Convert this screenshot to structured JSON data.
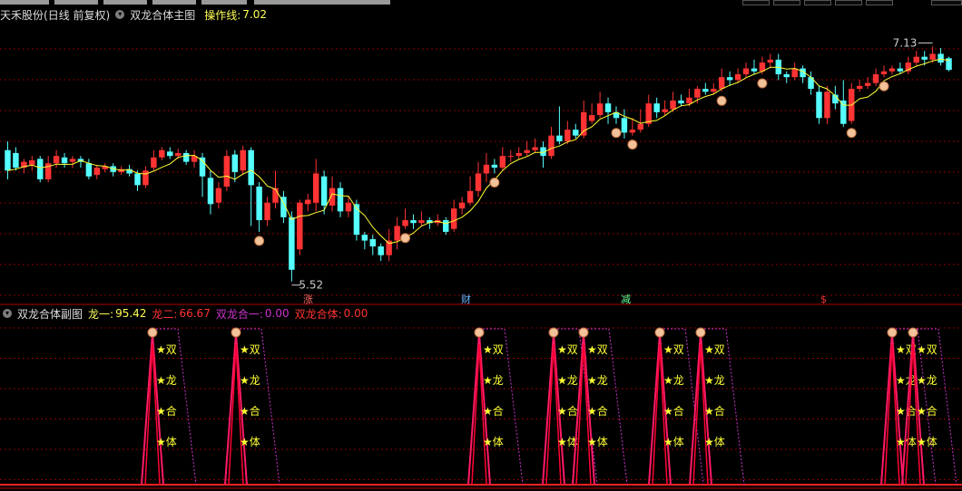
{
  "main_panel": {
    "stock_name": "天禾股份",
    "period": "(日线 前复权)",
    "indicator_name": "双龙合体主图",
    "op_label": "操作线:",
    "op_value": "7.02",
    "high_label": "7.13",
    "low_label": "5.52",
    "markers": [
      "涨",
      "财",
      "减",
      "$"
    ],
    "marker_colors": [
      "#ff6666",
      "#66b3ff",
      "#66ff99",
      "#ff3333"
    ]
  },
  "sub_panel": {
    "indicator_name": "双龙合体副图",
    "fields": [
      {
        "label": "龙一:",
        "value": "95.42",
        "color": "#ffff55"
      },
      {
        "label": "龙二:",
        "value": "66.67",
        "color": "#ff3333"
      },
      {
        "label": "双龙合一:",
        "value": "0.00",
        "color": "#cc33cc"
      },
      {
        "label": "双龙合体:",
        "value": "0.00",
        "color": "#ff3333"
      }
    ],
    "star_labels": [
      "★双",
      "★龙",
      "★合",
      "★体"
    ]
  },
  "colors": {
    "up": "#ff3333",
    "down": "#55ffff",
    "ma": "#ffff33",
    "grid": "#8a0000",
    "pink": "#cc33cc"
  },
  "chart_data": {
    "type": "candlestick",
    "title": "双龙合体主图",
    "ylabel": "",
    "ylim": [
      5.4,
      7.3
    ],
    "candles": [
      [
        6.42,
        6.28,
        6.48,
        6.22
      ],
      [
        6.4,
        6.3,
        6.44,
        6.28
      ],
      [
        6.3,
        6.34,
        6.36,
        6.26
      ],
      [
        6.32,
        6.35,
        6.38,
        6.28
      ],
      [
        6.36,
        6.22,
        6.38,
        6.2
      ],
      [
        6.22,
        6.33,
        6.38,
        6.2
      ],
      [
        6.33,
        6.38,
        6.42,
        6.3
      ],
      [
        6.37,
        6.33,
        6.4,
        6.3
      ],
      [
        6.34,
        6.36,
        6.38,
        6.3
      ],
      [
        6.36,
        6.34,
        6.38,
        6.3
      ],
      [
        6.33,
        6.24,
        6.36,
        6.22
      ],
      [
        6.25,
        6.3,
        6.32,
        6.22
      ],
      [
        6.29,
        6.31,
        6.33,
        6.27
      ],
      [
        6.31,
        6.27,
        6.33,
        6.24
      ],
      [
        6.27,
        6.29,
        6.31,
        6.25
      ],
      [
        6.29,
        6.26,
        6.32,
        6.24
      ],
      [
        6.26,
        6.18,
        6.28,
        6.14
      ],
      [
        6.18,
        6.28,
        6.31,
        6.16
      ],
      [
        6.3,
        6.37,
        6.42,
        6.28
      ],
      [
        6.37,
        6.42,
        6.44,
        6.35
      ],
      [
        6.41,
        6.38,
        6.44,
        6.36
      ],
      [
        6.38,
        6.4,
        6.43,
        6.36
      ],
      [
        6.4,
        6.34,
        6.42,
        6.32
      ],
      [
        6.34,
        6.38,
        6.42,
        6.3
      ],
      [
        6.37,
        6.24,
        6.4,
        6.1
      ],
      [
        6.23,
        6.05,
        6.28,
        5.98
      ],
      [
        6.06,
        6.16,
        6.2,
        6.02
      ],
      [
        6.17,
        6.38,
        6.42,
        6.14
      ],
      [
        6.39,
        6.27,
        6.42,
        6.2
      ],
      [
        6.28,
        6.42,
        6.45,
        6.25
      ],
      [
        6.42,
        6.18,
        6.44,
        5.9
      ],
      [
        6.17,
        5.94,
        6.2,
        5.86
      ],
      [
        5.94,
        6.06,
        6.1,
        5.9
      ],
      [
        6.06,
        6.16,
        6.28,
        6.02
      ],
      [
        6.1,
        5.96,
        6.14,
        5.92
      ],
      [
        5.96,
        5.6,
        6.0,
        5.52
      ],
      [
        5.74,
        6.06,
        6.08,
        5.7
      ],
      [
        6.05,
        6.08,
        6.12,
        6.0
      ],
      [
        6.06,
        6.26,
        6.36,
        6.0
      ],
      [
        6.24,
        6.04,
        6.28,
        5.98
      ],
      [
        6.04,
        6.16,
        6.24,
        6.0
      ],
      [
        6.16,
        6.0,
        6.2,
        5.96
      ],
      [
        6.0,
        6.06,
        6.1,
        5.96
      ],
      [
        6.05,
        5.84,
        6.08,
        5.8
      ],
      [
        5.84,
        5.8,
        5.86,
        5.74
      ],
      [
        5.81,
        5.76,
        5.84,
        5.7
      ],
      [
        5.76,
        5.7,
        5.78,
        5.66
      ],
      [
        5.7,
        5.8,
        5.88,
        5.66
      ],
      [
        5.8,
        5.9,
        5.96,
        5.74
      ],
      [
        5.9,
        5.94,
        6.02,
        5.88
      ],
      [
        5.94,
        5.92,
        5.98,
        5.88
      ],
      [
        5.92,
        5.94,
        6.0,
        5.9
      ],
      [
        5.94,
        5.92,
        5.96,
        5.88
      ],
      [
        5.92,
        5.94,
        5.98,
        5.9
      ],
      [
        5.94,
        5.86,
        5.96,
        5.84
      ],
      [
        5.88,
        6.02,
        6.08,
        5.86
      ],
      [
        6.02,
        6.06,
        6.1,
        5.98
      ],
      [
        6.06,
        6.14,
        6.24,
        6.04
      ],
      [
        6.14,
        6.26,
        6.34,
        6.1
      ],
      [
        6.26,
        6.32,
        6.4,
        6.2
      ],
      [
        6.32,
        6.3,
        6.36,
        6.26
      ],
      [
        6.3,
        6.38,
        6.44,
        6.28
      ],
      [
        6.38,
        6.38,
        6.42,
        6.34
      ],
      [
        6.38,
        6.4,
        6.44,
        6.36
      ],
      [
        6.4,
        6.42,
        6.48,
        6.38
      ],
      [
        6.42,
        6.44,
        6.5,
        6.4
      ],
      [
        6.44,
        6.38,
        6.48,
        6.3
      ],
      [
        6.38,
        6.52,
        6.58,
        6.36
      ],
      [
        6.52,
        6.48,
        6.72,
        6.46
      ],
      [
        6.48,
        6.56,
        6.62,
        6.46
      ],
      [
        6.56,
        6.52,
        6.6,
        6.5
      ],
      [
        6.52,
        6.68,
        6.76,
        6.5
      ],
      [
        6.62,
        6.66,
        6.74,
        6.6
      ],
      [
        6.66,
        6.74,
        6.82,
        6.64
      ],
      [
        6.74,
        6.68,
        6.78,
        6.6
      ],
      [
        6.68,
        6.64,
        6.72,
        6.6
      ],
      [
        6.64,
        6.54,
        6.7,
        6.5
      ],
      [
        6.54,
        6.56,
        6.64,
        6.52
      ],
      [
        6.56,
        6.6,
        6.7,
        6.54
      ],
      [
        6.6,
        6.74,
        6.8,
        6.58
      ],
      [
        6.74,
        6.68,
        6.78,
        6.64
      ],
      [
        6.68,
        6.7,
        6.76,
        6.66
      ],
      [
        6.7,
        6.76,
        6.82,
        6.68
      ],
      [
        6.76,
        6.74,
        6.8,
        6.72
      ],
      [
        6.74,
        6.78,
        6.84,
        6.72
      ],
      [
        6.78,
        6.84,
        6.86,
        6.74
      ],
      [
        6.84,
        6.82,
        6.88,
        6.8
      ],
      [
        6.82,
        6.84,
        6.88,
        6.8
      ],
      [
        6.84,
        6.92,
        6.98,
        6.82
      ],
      [
        6.92,
        6.9,
        6.96,
        6.86
      ],
      [
        6.9,
        6.94,
        6.98,
        6.88
      ],
      [
        6.94,
        6.98,
        7.02,
        6.92
      ],
      [
        6.98,
        6.96,
        7.04,
        6.94
      ],
      [
        6.96,
        7.02,
        7.06,
        6.94
      ],
      [
        7.02,
        7.04,
        7.08,
        6.98
      ],
      [
        7.04,
        6.94,
        7.08,
        6.9
      ],
      [
        6.94,
        6.92,
        6.96,
        6.88
      ],
      [
        6.92,
        6.98,
        7.02,
        6.9
      ],
      [
        6.98,
        6.92,
        7.0,
        6.88
      ],
      [
        6.92,
        6.84,
        6.96,
        6.8
      ],
      [
        6.82,
        6.64,
        6.86,
        6.6
      ],
      [
        6.64,
        6.82,
        6.86,
        6.6
      ],
      [
        6.8,
        6.74,
        6.86,
        6.7
      ],
      [
        6.76,
        6.6,
        6.9,
        6.58
      ],
      [
        6.62,
        6.84,
        6.88,
        6.6
      ],
      [
        6.84,
        6.86,
        6.9,
        6.82
      ],
      [
        6.86,
        6.88,
        6.92,
        6.84
      ],
      [
        6.88,
        6.94,
        6.98,
        6.86
      ],
      [
        6.94,
        6.96,
        7.0,
        6.92
      ],
      [
        6.96,
        6.98,
        7.0,
        6.94
      ],
      [
        6.98,
        6.96,
        7.02,
        6.94
      ],
      [
        6.96,
        7.02,
        7.06,
        6.94
      ],
      [
        7.02,
        7.06,
        7.1,
        7.0
      ],
      [
        7.06,
        7.04,
        7.1,
        7.0
      ],
      [
        7.04,
        7.08,
        7.13,
        7.02
      ],
      [
        7.08,
        7.02,
        7.12,
        7.0
      ],
      [
        7.05,
        6.97,
        7.06,
        6.96
      ]
    ]
  }
}
